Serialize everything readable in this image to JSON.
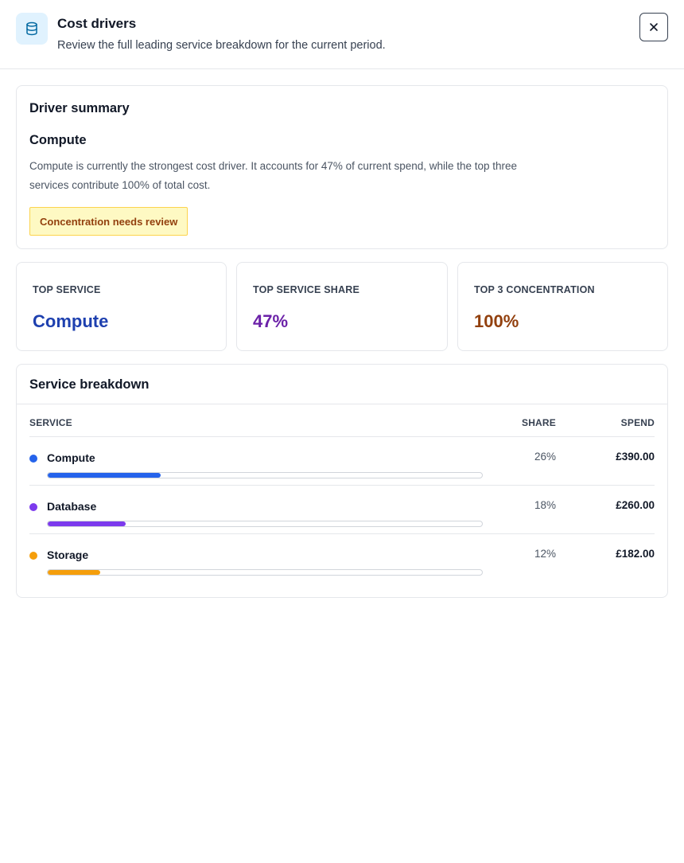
{
  "header": {
    "title": "Cost drivers",
    "subtitle": "Review the full leading service breakdown for the current period.",
    "icon": "database-icon",
    "close_icon": "close-icon"
  },
  "summary": {
    "heading": "Driver summary",
    "service": "Compute",
    "text": "Compute is currently the strongest cost driver. It accounts for 47% of current spend, while the top three services contribute 100% of total cost.",
    "badge": "Concentration needs review"
  },
  "metrics": [
    {
      "label": "TOP SERVICE",
      "value": "Compute",
      "color": "#1e40af"
    },
    {
      "label": "TOP SERVICE SHARE",
      "value": "47%",
      "color": "#6b21a8"
    },
    {
      "label": "TOP 3 CONCENTRATION",
      "value": "100%",
      "color": "#92400e"
    }
  ],
  "breakdown": {
    "title": "Service breakdown",
    "columns": {
      "service": "SERVICE",
      "share": "SHARE",
      "spend": "SPEND"
    },
    "rows": [
      {
        "name": "Compute",
        "share": "26%",
        "share_fraction": 0.26,
        "spend": "£390.00",
        "color": "#2563eb"
      },
      {
        "name": "Database",
        "share": "18%",
        "share_fraction": 0.18,
        "spend": "£260.00",
        "color": "#7c3aed"
      },
      {
        "name": "Storage",
        "share": "12%",
        "share_fraction": 0.12,
        "spend": "£182.00",
        "color": "#f59e0b"
      }
    ]
  }
}
